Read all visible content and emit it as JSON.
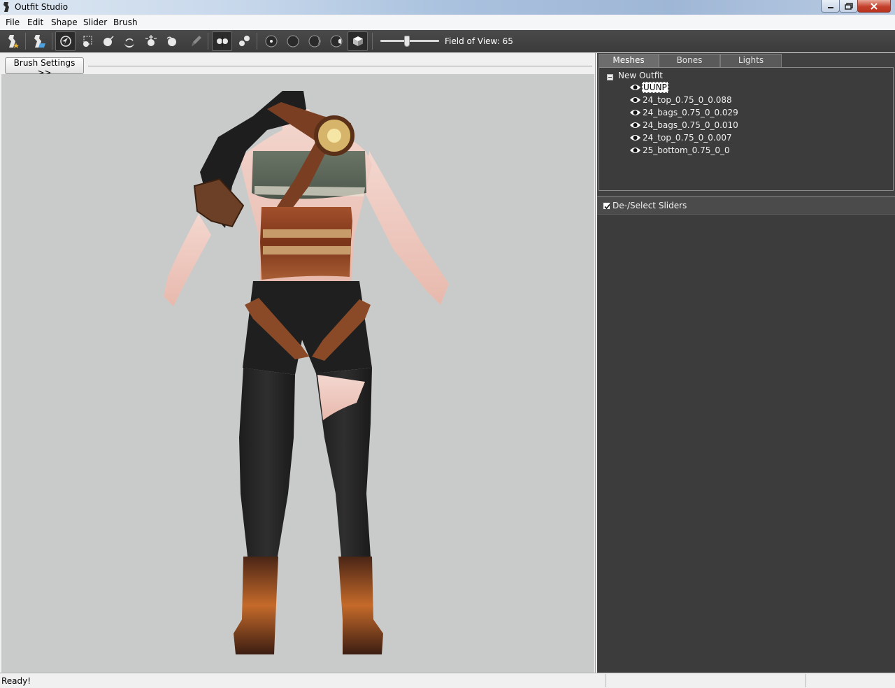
{
  "window": {
    "title": "Outfit Studio"
  },
  "menu": {
    "items": [
      "File",
      "Edit",
      "Shape",
      "Slider",
      "Brush"
    ]
  },
  "toolbar": {
    "field_of_view_label": "Field of View: 65",
    "field_of_view_value": 65,
    "tools": [
      "load-reference-icon",
      "load-outfit-icon",
      "select-brush-icon",
      "mask-brush-icon",
      "inflate-brush-icon",
      "deflate-brush-icon",
      "move-brush-icon",
      "smooth-brush-icon",
      "weight-brush-icon",
      "x-mirror-icon",
      "connected-icon",
      "vertex-view-icon",
      "wireframe-view-icon",
      "lighting-icon",
      "texture-icon",
      "render-mode-icon"
    ]
  },
  "left_panel": {
    "brush_settings_label": "Brush Settings >>"
  },
  "right_panel": {
    "tabs": [
      {
        "label": "Meshes",
        "active": true
      },
      {
        "label": "Bones",
        "active": false
      },
      {
        "label": "Lights",
        "active": false
      }
    ],
    "tree": {
      "root": "New Outfit",
      "meshes": [
        "UUNP",
        "24_top_0.75_0_0.088",
        "24_bags_0.75_0_0.029",
        "24_bags_0.75_0_0.010",
        "24_top_0.75_0_0.007",
        "25_bottom_0.75_0_0"
      ],
      "selected": "UUNP"
    },
    "sliders_header": {
      "label": "De-/Select Sliders",
      "checked": true
    }
  },
  "status": {
    "text": "Ready!"
  },
  "colors": {
    "panel_dark": "#3c3c3c",
    "toolbar": "#3b3b3b",
    "viewport": "#c9cbca",
    "selection": "#ffffff"
  }
}
